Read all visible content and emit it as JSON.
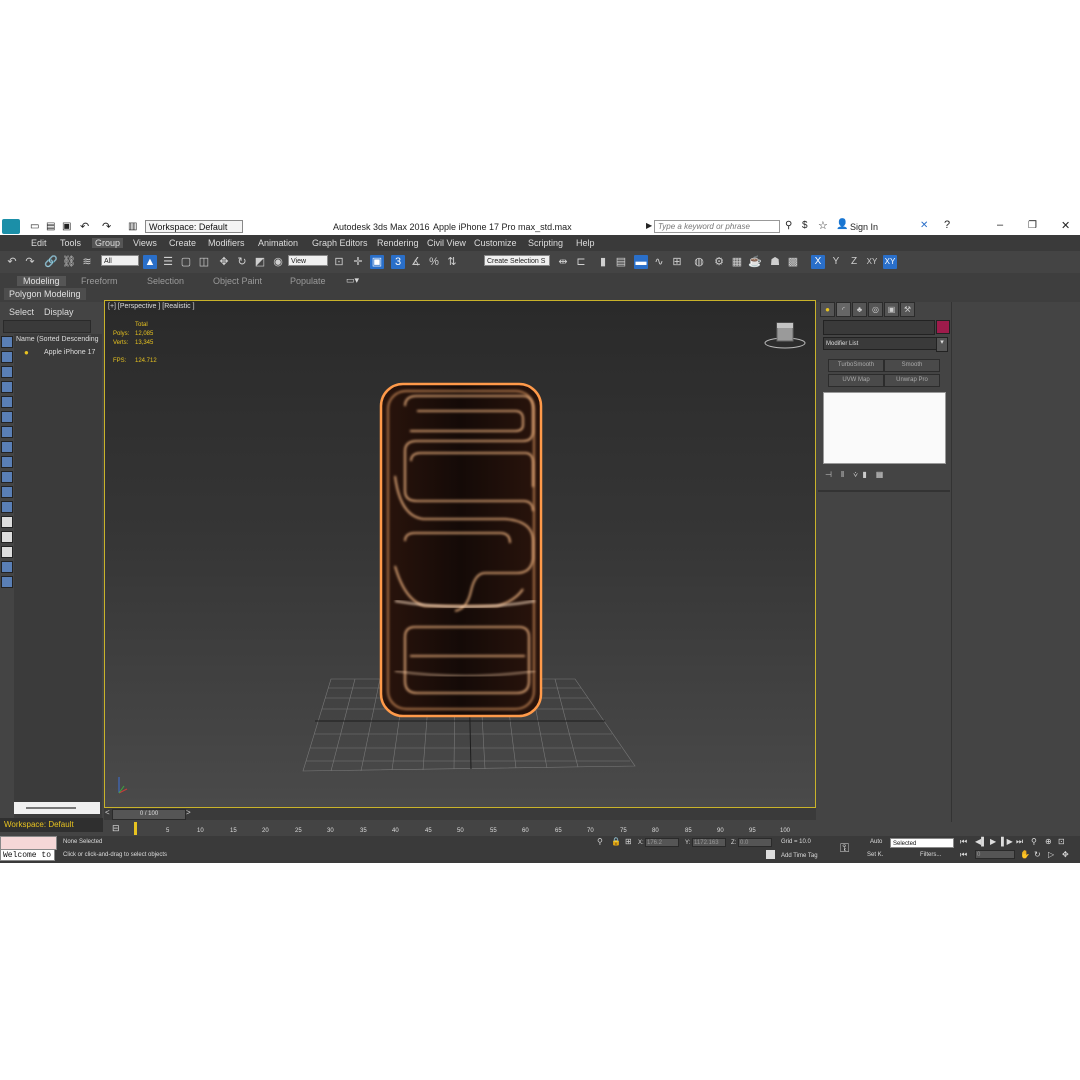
{
  "titlebar": {
    "app_title": "Autodesk 3ds Max 2016",
    "file_name": "Apple iPhone 17 Pro max_std.max",
    "workspace": "Workspace: Default",
    "search_placeholder": "Type a keyword or phrase",
    "sign_in": "Sign In"
  },
  "menu": [
    "Edit",
    "Tools",
    "Group",
    "Views",
    "Create",
    "Modifiers",
    "Animation",
    "Graph Editors",
    "Rendering",
    "Civil View",
    "Customize",
    "Scripting",
    "Help"
  ],
  "toolbar": {
    "filter_value": "All",
    "refcoord_value": "View",
    "selection_set": "Create Selection S",
    "axis_x": "X",
    "axis_y": "Y",
    "axis_z": "Z",
    "axis_xy": "XY",
    "axis_xy2": "XY"
  },
  "ribbon": {
    "tabs": [
      "Modeling",
      "Freeform",
      "Selection",
      "Object Paint",
      "Populate"
    ],
    "sub": "Polygon Modeling"
  },
  "scene_explorer": {
    "tab_select": "Select",
    "tab_display": "Display",
    "column_header": "Name (Sorted Descending",
    "item": "Apple iPhone 17"
  },
  "viewport": {
    "label": "[+] [Perspective ] [Realistic ]",
    "stats_total": "Total",
    "polys_label": "Polys:",
    "polys_value": "12,085",
    "verts_label": "Verts:",
    "verts_value": "13,345",
    "fps_label": "FPS:",
    "fps_value": "124.712"
  },
  "command_panel": {
    "modifier_list": "Modifier List",
    "buttons": [
      "TurboSmooth",
      "Smooth",
      "UVW Map",
      "Unwrap Pro"
    ],
    "object_color": "#9e1b4b"
  },
  "timeline": {
    "slider": "0 / 100",
    "ticks": [
      "0",
      "5",
      "10",
      "15",
      "20",
      "25",
      "30",
      "35",
      "40",
      "45",
      "50",
      "55",
      "60",
      "65",
      "70",
      "75",
      "80",
      "85",
      "90",
      "95",
      "100"
    ],
    "workspace": "Workspace: Default"
  },
  "status": {
    "listener": "Welcome to",
    "selection": "None Selected",
    "prompt": "Click or click-and-drag to select objects",
    "x_label": "X:",
    "x_value": "176.2",
    "y_label": "Y:",
    "y_value": "1172.163",
    "z_label": "Z:",
    "z_value": "0.0",
    "grid": "Grid = 10.0",
    "add_time_tag": "Add Time Tag",
    "auto": "Auto",
    "set_key": "Set K.",
    "key_filter": "Selected",
    "filters": "Filters...",
    "frame": "0"
  },
  "colors": {
    "accent_yellow": "#e8c320",
    "highlight_blue": "#2a6fc9",
    "phone_glow": "#ff9a4a"
  }
}
